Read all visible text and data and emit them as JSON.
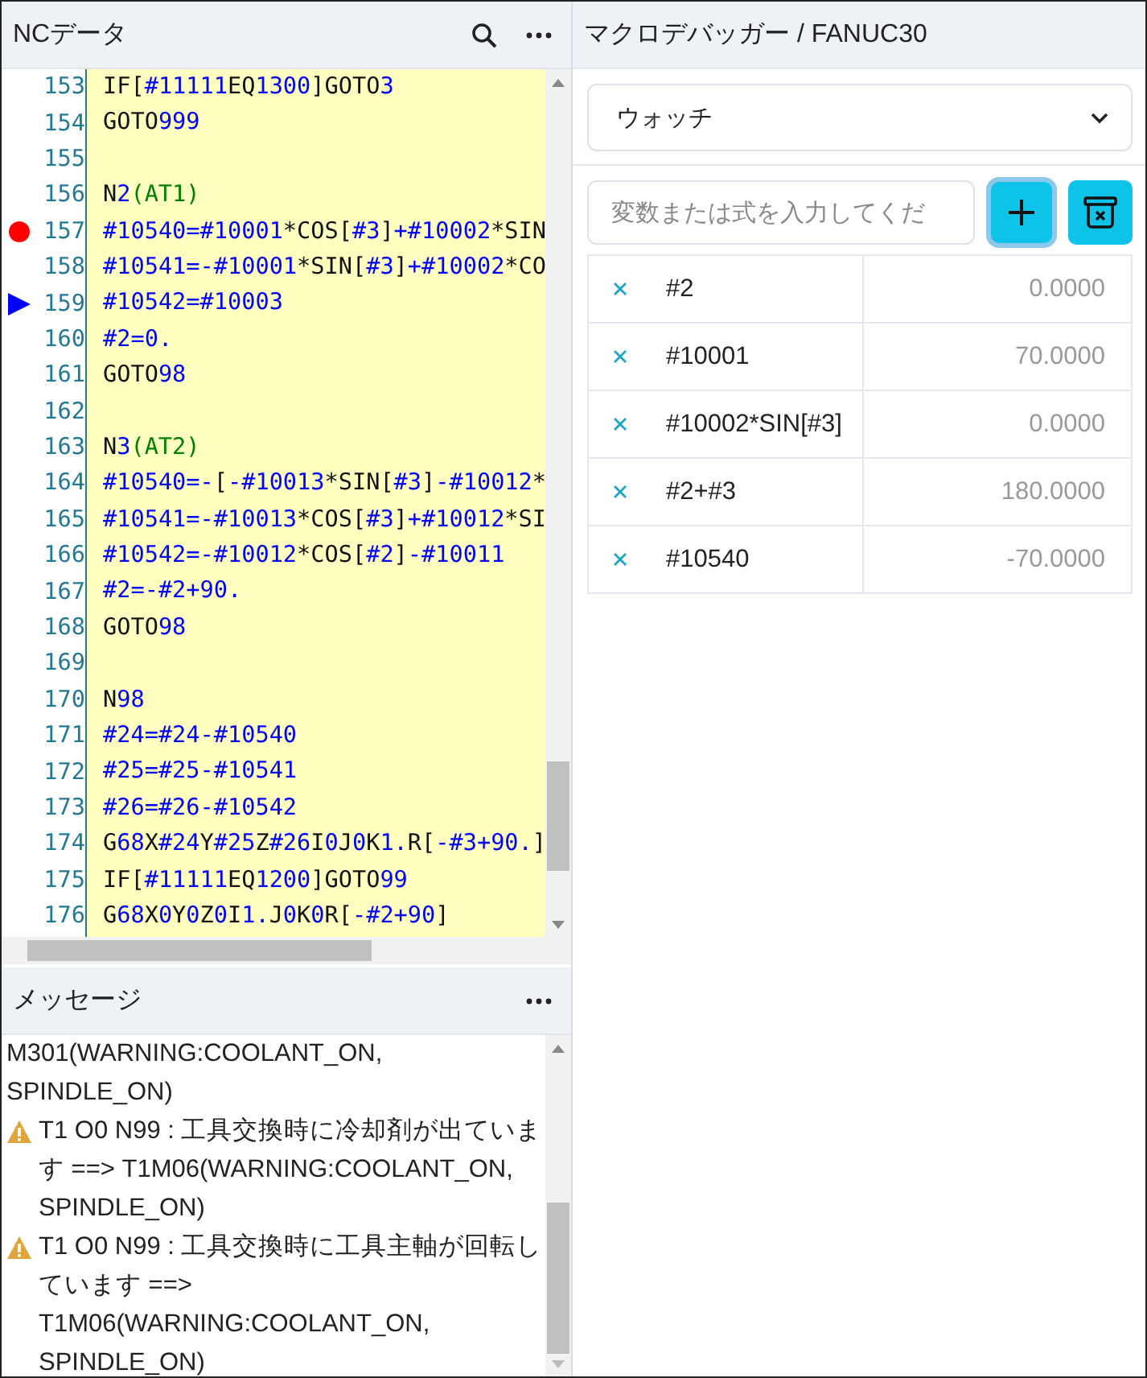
{
  "editor": {
    "title": "NCデータ",
    "lines": [
      {
        "no": "153",
        "text": "IF[#11111EQ1300]GOTO3"
      },
      {
        "no": "154",
        "text": "GOTO999"
      },
      {
        "no": "155"
      },
      {
        "no": "156",
        "text": "N2(AT1)"
      },
      {
        "no": "157",
        "text": "#10540=#10001*COS[#3]+#10002*SIN",
        "breakpoint": true
      },
      {
        "no": "158",
        "text": "#10541=-#10001*SIN[#3]+#10002*CO"
      },
      {
        "no": "159",
        "text": "#10542=#10003",
        "current": true
      },
      {
        "no": "160",
        "text": "#2=0."
      },
      {
        "no": "161",
        "text": "GOTO98"
      },
      {
        "no": "162"
      },
      {
        "no": "163",
        "text": "N3(AT2)"
      },
      {
        "no": "164",
        "text": "#10540=-[-#10013*SIN[#3]-#10012*"
      },
      {
        "no": "165",
        "text": "#10541=-#10013*COS[#3]+#10012*SI"
      },
      {
        "no": "166",
        "text": "#10542=-#10012*COS[#2]-#10011"
      },
      {
        "no": "167",
        "text": "#2=-#2+90."
      },
      {
        "no": "168",
        "text": "GOTO98"
      },
      {
        "no": "169"
      },
      {
        "no": "170",
        "text": "N98"
      },
      {
        "no": "171",
        "text": "#24=#24-#10540"
      },
      {
        "no": "172",
        "text": "#25=#25-#10541"
      },
      {
        "no": "173",
        "text": "#26=#26-#10542"
      },
      {
        "no": "174",
        "text": "G68X#24Y#25Z#26I0J0K1.R[-#3+90.]"
      },
      {
        "no": "175",
        "text": "IF[#11111EQ1200]GOTO99"
      },
      {
        "no": "176",
        "text": "G68X0Y0Z0I1.J0K0R[-#2+90]"
      }
    ]
  },
  "messages": {
    "title": "メッセージ",
    "items": [
      {
        "kind": "plain",
        "text": "M301(WARNING:COOLANT_ON, SPINDLE_ON)"
      },
      {
        "kind": "warning",
        "text": "T1 O0 N99 : 工具交換時に冷却剤が出ています ==> T1M06(WARNING:COOLANT_ON, SPINDLE_ON)"
      },
      {
        "kind": "warning",
        "text": "T1 O0 N99 : 工具交換時に工具主軸が回転しています ==> T1M06(WARNING:COOLANT_ON, SPINDLE_ON)"
      }
    ]
  },
  "debugger": {
    "title": "マクロデバッガー / FANUC30",
    "view": "ウォッチ",
    "expression": {
      "placeholder": "変数または式を入力してくだ"
    },
    "watches": [
      {
        "name": "#2",
        "value": "0.0000"
      },
      {
        "name": "#10001",
        "value": "70.0000"
      },
      {
        "name": "#10002*SIN[#3]",
        "value": "0.0000"
      },
      {
        "name": "#2+#3",
        "value": "180.0000"
      },
      {
        "name": "#10540",
        "value": "-70.0000"
      }
    ]
  }
}
